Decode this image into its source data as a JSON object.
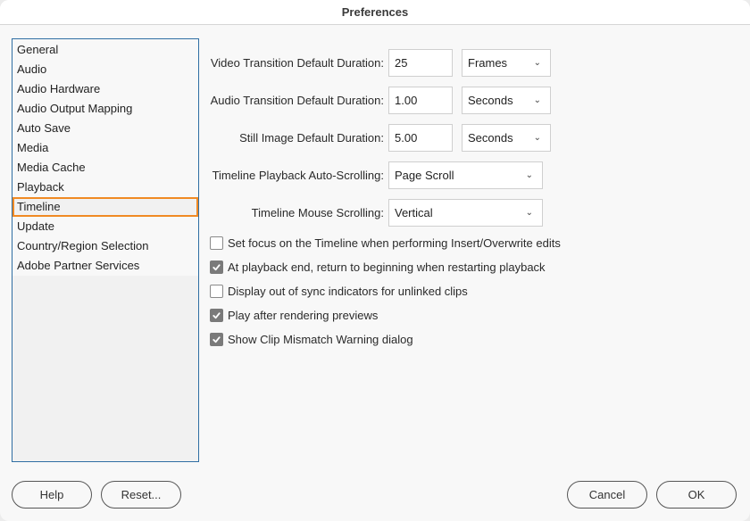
{
  "window": {
    "title": "Preferences"
  },
  "sidebar": {
    "items": [
      {
        "label": "General"
      },
      {
        "label": "Audio"
      },
      {
        "label": "Audio Hardware"
      },
      {
        "label": "Audio Output Mapping"
      },
      {
        "label": "Auto Save"
      },
      {
        "label": "Media"
      },
      {
        "label": "Media Cache"
      },
      {
        "label": "Playback"
      },
      {
        "label": "Timeline",
        "selected": true
      },
      {
        "label": "Update"
      },
      {
        "label": "Country/Region Selection"
      },
      {
        "label": "Adobe Partner Services"
      }
    ],
    "selected_color": "#f08a24"
  },
  "settings": {
    "video_transition": {
      "label": "Video Transition Default Duration:",
      "value": "25",
      "unit": "Frames"
    },
    "audio_transition": {
      "label": "Audio Transition Default Duration:",
      "value": "1.00",
      "unit": "Seconds"
    },
    "still_image": {
      "label": "Still Image Default Duration:",
      "value": "5.00",
      "unit": "Seconds"
    },
    "auto_scrolling": {
      "label": "Timeline Playback Auto-Scrolling:",
      "value": "Page Scroll"
    },
    "mouse_scrolling": {
      "label": "Timeline Mouse Scrolling:",
      "value": "Vertical"
    }
  },
  "checkboxes": [
    {
      "label": "Set focus on the Timeline when performing Insert/Overwrite edits",
      "checked": false
    },
    {
      "label": "At playback end, return to beginning when restarting playback",
      "checked": true
    },
    {
      "label": "Display out of sync indicators for unlinked clips",
      "checked": false
    },
    {
      "label": "Play after rendering previews",
      "checked": true
    },
    {
      "label": "Show Clip Mismatch Warning dialog",
      "checked": true
    }
  ],
  "buttons": {
    "help": "Help",
    "reset": "Reset...",
    "cancel": "Cancel",
    "ok": "OK"
  }
}
